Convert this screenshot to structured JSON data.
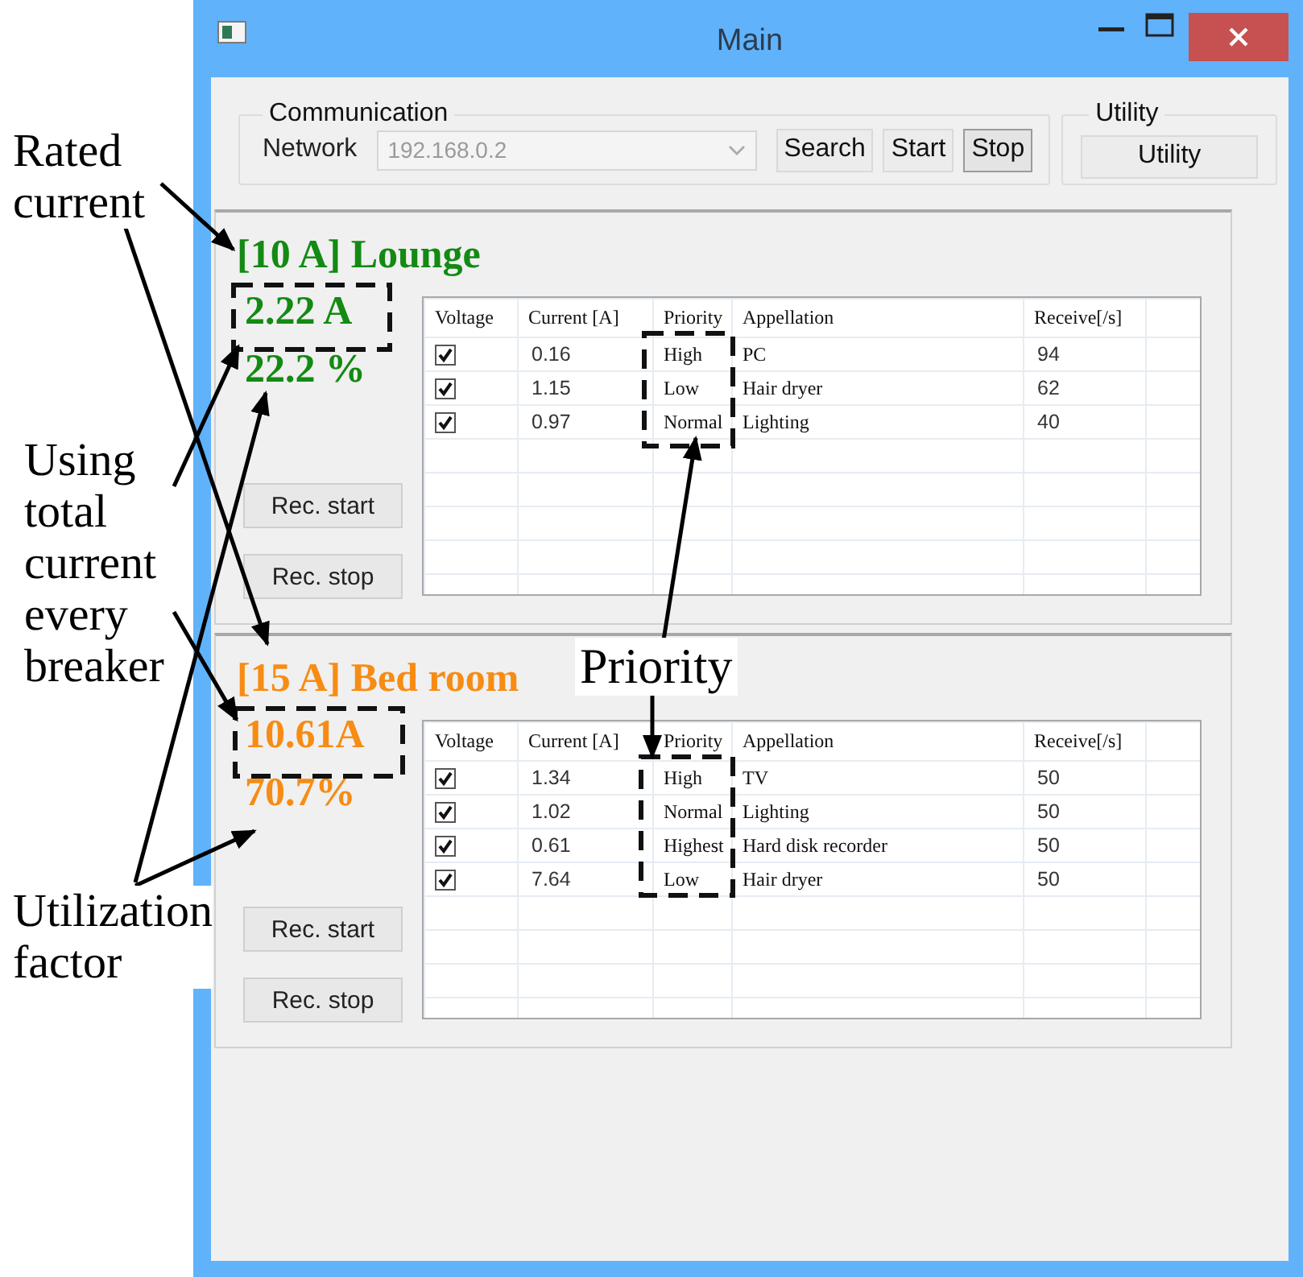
{
  "window": {
    "title": "Main"
  },
  "communication": {
    "label": "Communication",
    "network_label": "Network",
    "network_value": "192.168.0.2",
    "network_disabled": true,
    "buttons": [
      {
        "label": "Search",
        "focused": false
      },
      {
        "label": "Start",
        "focused": false
      },
      {
        "label": "Stop",
        "focused": true
      }
    ]
  },
  "utility": {
    "label": "Utility",
    "button": "Utility"
  },
  "breakers": [
    {
      "title": "[10 A] Lounge",
      "color": "#138a13",
      "current": "2.22 A",
      "utilization": "22.2 %",
      "buttons": [
        "Rec. start",
        "Rec. stop"
      ],
      "columns": [
        "Voltage",
        "Current [A]",
        "Priority",
        "Appellation",
        "Receive[/s]"
      ],
      "rows": [
        {
          "checked": true,
          "current": "0.16",
          "priority": "High",
          "appellation": "PC",
          "receive": "94"
        },
        {
          "checked": true,
          "current": "1.15",
          "priority": "Low",
          "appellation": "Hair dryer",
          "receive": "62"
        },
        {
          "checked": true,
          "current": "0.97",
          "priority": "Normal",
          "appellation": "Lighting",
          "receive": "40"
        }
      ]
    },
    {
      "title": "[15 A] Bed room",
      "color": "#f78c14",
      "current": "10.61A",
      "utilization": "70.7%",
      "buttons": [
        "Rec. start",
        "Rec. stop"
      ],
      "columns": [
        "Voltage",
        "Current [A]",
        "Priority",
        "Appellation",
        "Receive[/s]"
      ],
      "rows": [
        {
          "checked": true,
          "current": "1.34",
          "priority": "High",
          "appellation": "TV",
          "receive": "50"
        },
        {
          "checked": true,
          "current": "1.02",
          "priority": "Normal",
          "appellation": "Lighting",
          "receive": "50"
        },
        {
          "checked": true,
          "current": "0.61",
          "priority": "Highest",
          "appellation": "Hard disk recorder",
          "receive": "50"
        },
        {
          "checked": true,
          "current": "7.64",
          "priority": "Low",
          "appellation": "Hair dryer",
          "receive": "50"
        }
      ]
    }
  ],
  "annotations": [
    {
      "kind": "side",
      "text": "Rated\ncurrent"
    },
    {
      "kind": "side",
      "text": "Using\ntotal\ncurrent\nevery\nbreaker"
    },
    {
      "kind": "side",
      "text": "Utilization\nfactor"
    },
    {
      "kind": "callout",
      "text": "Priority"
    }
  ]
}
